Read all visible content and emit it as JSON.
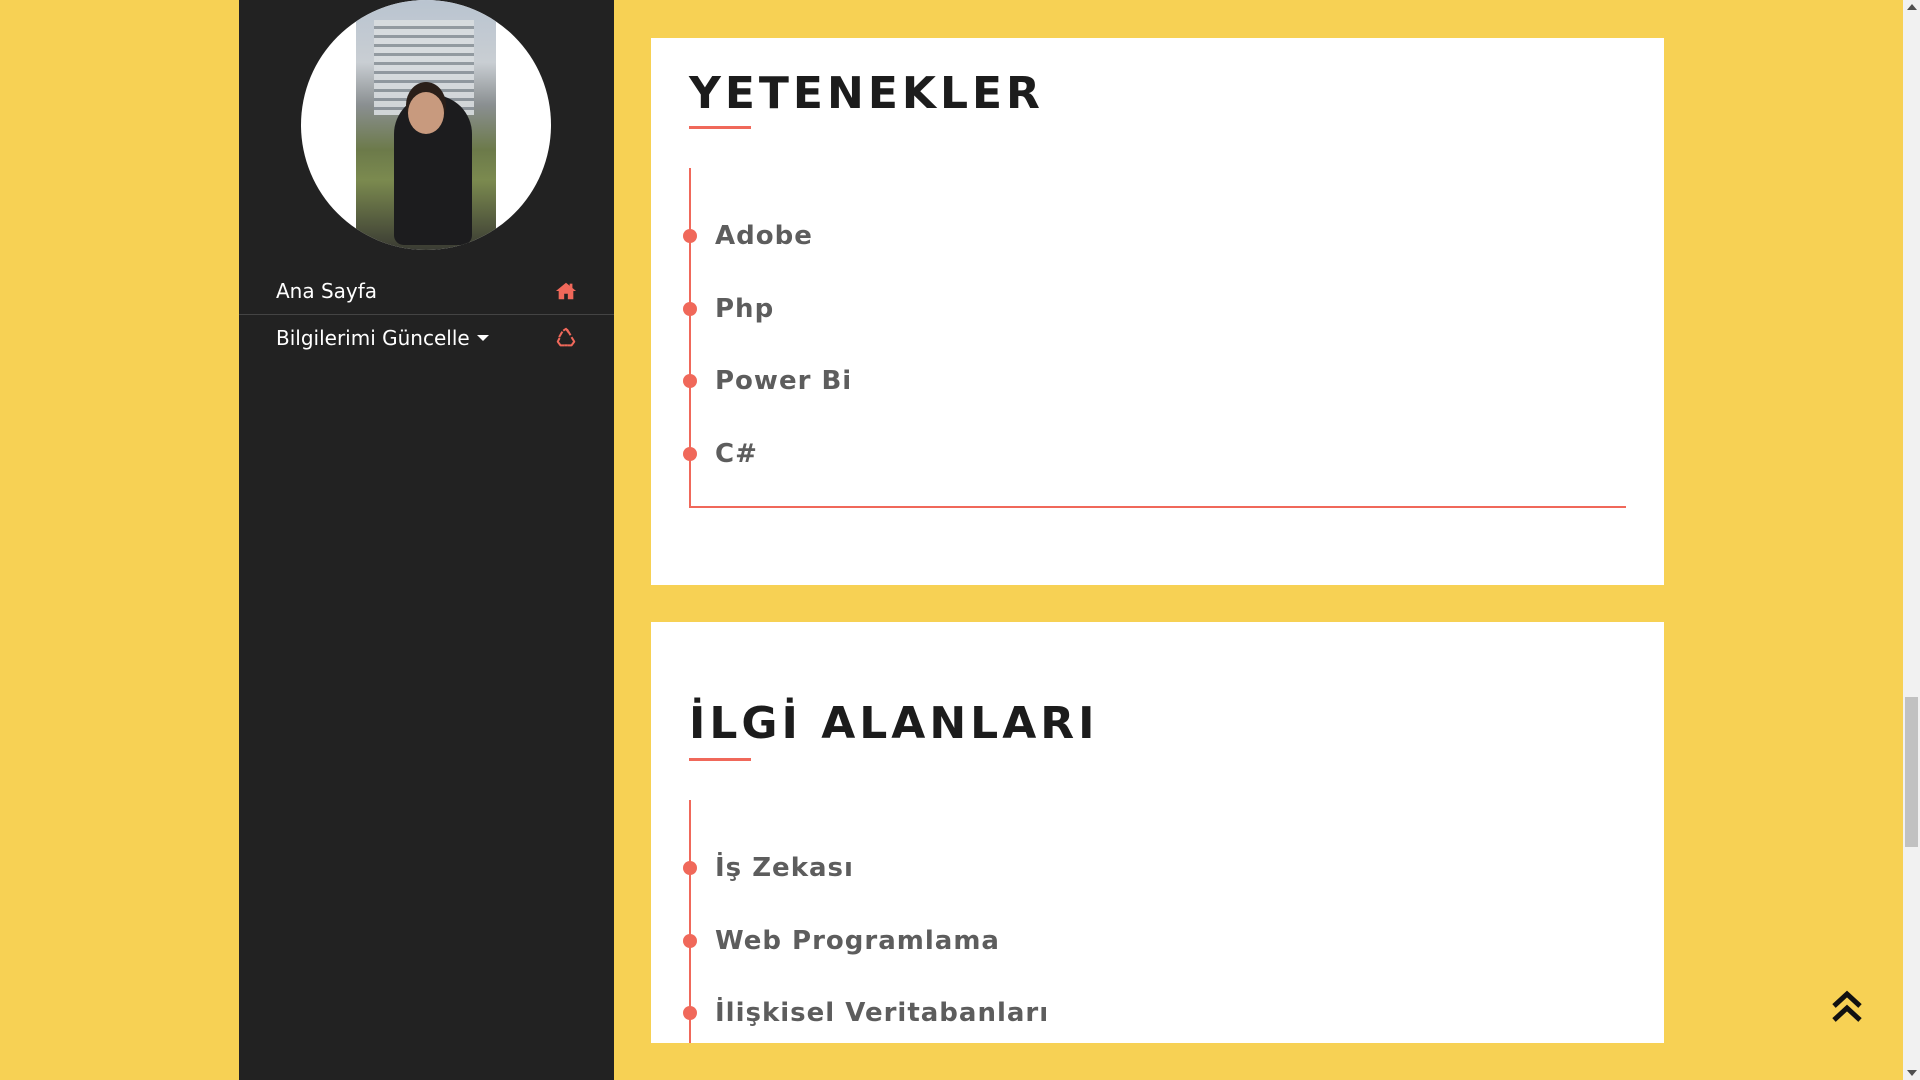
{
  "colors": {
    "background": "#f7d154",
    "sidebar": "#222222",
    "accent": "#f0685a",
    "card": "#ffffff"
  },
  "sidebar": {
    "nav": [
      {
        "label": "Ana Sayfa",
        "icon": "home-icon"
      },
      {
        "label": "Bilgilerimi Güncelle",
        "icon": "recycle-icon",
        "has_dropdown": true
      }
    ]
  },
  "skills": {
    "title": "YETENEKLER",
    "items": [
      "Adobe",
      "Php",
      "Power Bi",
      "C#"
    ]
  },
  "interests": {
    "title": "İLGİ ALANLARI",
    "items": [
      "İş Zekası",
      "Web Programlama",
      "İlişkisel Veritabanları"
    ]
  },
  "back_to_top": {
    "icon": "double-chevron-up-icon"
  }
}
